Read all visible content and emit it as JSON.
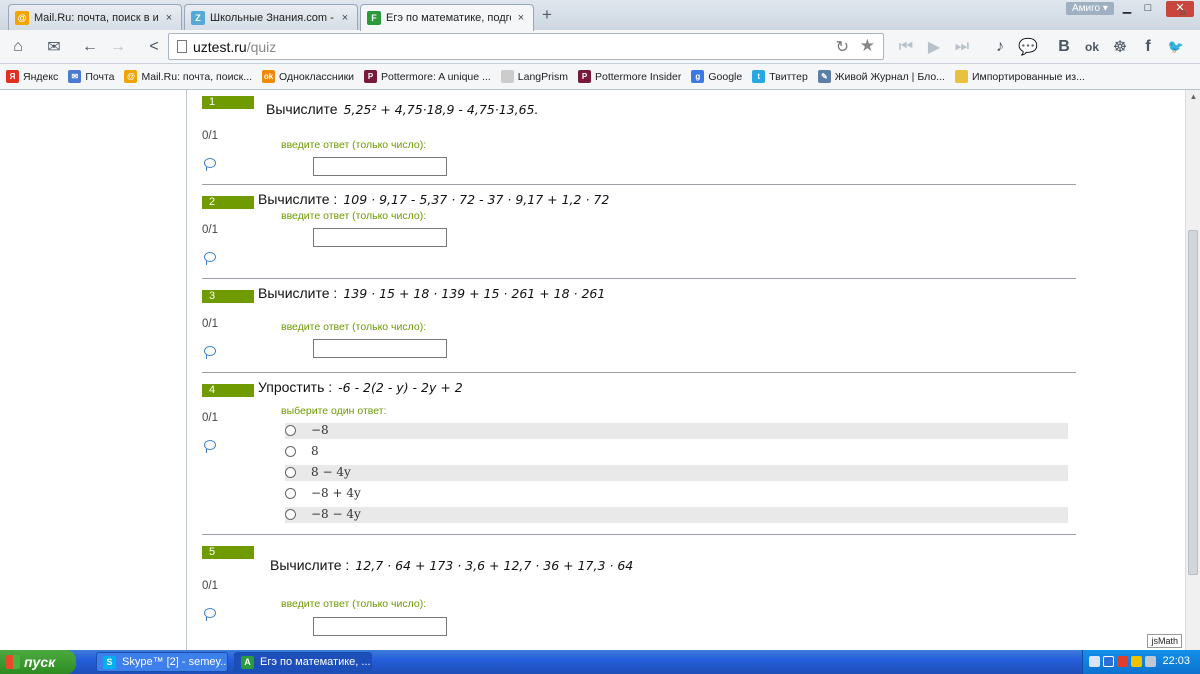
{
  "tabs": [
    {
      "title": "Mail.Ru: почта, поиск в интер",
      "close": "×",
      "icon": "mailru-icon",
      "color": "#f2a400",
      "glyph": "@"
    },
    {
      "title": "Школьные Знания.com - Реш",
      "close": "×",
      "icon": "znanija-icon",
      "color": "#56a9d6",
      "glyph": "Z"
    },
    {
      "title": "Егэ по математике, подготов",
      "close": "×",
      "icon": "uztest-icon",
      "color": "#2a9a3c",
      "glyph": "F"
    }
  ],
  "window": {
    "newtab": "+",
    "profile": "Амиго ▾",
    "minimize": "▁",
    "maximize": "□",
    "close": "✕"
  },
  "toolbar": {
    "home": "⌂",
    "mail": "✉",
    "back": "←",
    "forward": "→",
    "share": "<",
    "url_host": "uztest.ru",
    "url_path": "/quiz",
    "reload": "↻",
    "star": "★",
    "media_prev": "⏮",
    "media_play": "▶",
    "media_next": "⏭",
    "music": "♪",
    "chat": "💬",
    "vk": "B",
    "ok": "ok",
    "games": "☸",
    "fb": "f",
    "twitter": "🐦"
  },
  "bookmarks": [
    {
      "label": "Яндекс",
      "color": "#e03020",
      "glyph": "Я"
    },
    {
      "label": "Почта",
      "color": "#4a7bd0",
      "glyph": "✉"
    },
    {
      "label": "Mail.Ru: почта, поиск...",
      "color": "#f2a400",
      "glyph": "@"
    },
    {
      "label": "Одноклассники",
      "color": "#f08a00",
      "glyph": "ok"
    },
    {
      "label": "Pottermore: A unique ...",
      "color": "#7a1a3a",
      "glyph": "P"
    },
    {
      "label": "LangPrism",
      "color": "#cccccc",
      "glyph": ""
    },
    {
      "label": "Pottermore Insider",
      "color": "#7a1a3a",
      "glyph": "P"
    },
    {
      "label": "Google",
      "color": "#3b78e7",
      "glyph": "g"
    },
    {
      "label": "Твиттер",
      "color": "#28a8e0",
      "glyph": "t"
    },
    {
      "label": "Живой Журнал | Бло...",
      "color": "#5b7fa8",
      "glyph": "✎"
    },
    {
      "label": "Импортированные из...",
      "color": "#e8c23c",
      "glyph": ""
    }
  ],
  "bookmarks_more": "»",
  "questions": [
    {
      "num": "1",
      "label": "Вычислите",
      "expr": "5,25² + 4,75·18,9 - 4,75·13,65.",
      "score": "0/1",
      "prompt": "введите ответ (только число):"
    },
    {
      "num": "2",
      "label": "Вычислите :",
      "expr": "109 · 9,17 - 5,37 · 72 - 37 · 9,17 + 1,2 · 72",
      "score": "0/1",
      "prompt": "введите ответ (только число):"
    },
    {
      "num": "3",
      "label": "Вычислите :",
      "expr": "139 · 15 + 18 · 139 + 15 · 261 + 18 · 261",
      "score": "0/1",
      "prompt": "введите ответ (только число):"
    },
    {
      "num": "4",
      "label": "Упростить :",
      "expr": "-6 - 2(2 - y) - 2y + 2",
      "score": "0/1",
      "prompt": "выберите один ответ:",
      "options": [
        "−8",
        "8",
        "8 − 4y",
        "−8 + 4y",
        "−8 − 4y"
      ]
    },
    {
      "num": "5",
      "label": "Вычислите :",
      "expr": "12,7 · 64 + 173 · 3,6 + 12,7 · 36 + 17,3 · 64",
      "score": "0/1",
      "prompt": "введите ответ (только число):"
    }
  ],
  "jsmath": "jsMath",
  "taskbar": {
    "start": "пуск",
    "tasks": [
      {
        "label": "Skype™ [2] - semey...",
        "color": "#00aff0",
        "glyph": "S"
      },
      {
        "label": "Егэ по математике, ...",
        "color": "#2a9a3c",
        "glyph": "A"
      }
    ],
    "clock": "22:03"
  }
}
